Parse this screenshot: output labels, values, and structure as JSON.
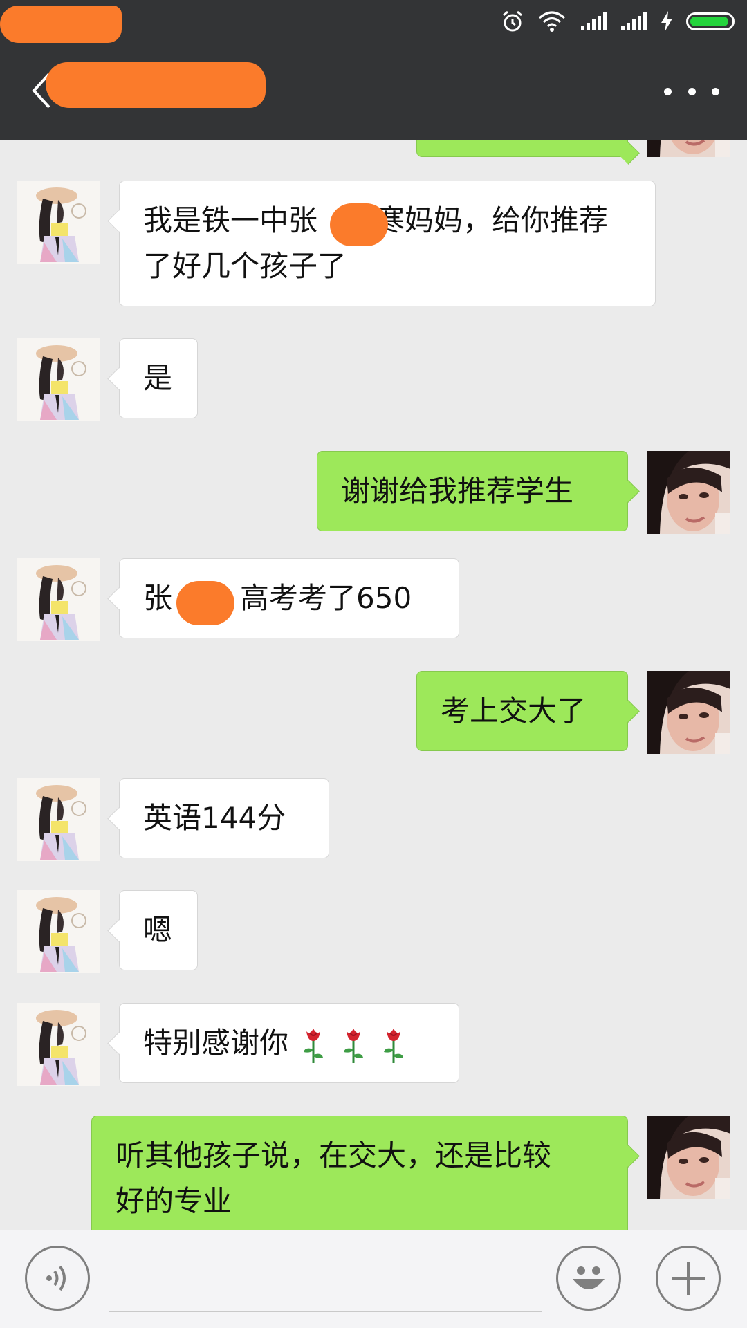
{
  "header": {
    "title": "",
    "back_icon": "chevron-left-icon",
    "more_icon": "more-dots-icon"
  },
  "status_bar": {
    "icons": [
      "alarm-icon",
      "wifi-icon",
      "signal-icon",
      "signal-icon",
      "charging-icon",
      "battery-icon"
    ],
    "battery_color": "#25d43d"
  },
  "colors": {
    "topbar": "#333436",
    "chat_background": "#ebebeb",
    "bubble_received": "#ffffff",
    "bubble_sent": "#9de85a",
    "redaction": "#fb7b2b"
  },
  "messages": [
    {
      "side": "left",
      "lines": [
        "我是铁一中张",
        "寒妈妈，给你推荐",
        "了好几个孩子了"
      ]
    },
    {
      "side": "left",
      "text": "是"
    },
    {
      "side": "right",
      "text": "谢谢给我推荐学生"
    },
    {
      "side": "left",
      "parts": [
        "张",
        "高考考了650"
      ]
    },
    {
      "side": "right",
      "text": "考上交大了"
    },
    {
      "side": "left",
      "text": "英语144分"
    },
    {
      "side": "left",
      "text": "嗯"
    },
    {
      "side": "left",
      "text": "特别感谢你",
      "emoji": [
        "rose-icon",
        "rose-icon",
        "rose-icon"
      ]
    },
    {
      "side": "right",
      "lines": [
        "听其他孩子说，在交大，还是比较",
        "好的专业"
      ]
    }
  ],
  "input_bar": {
    "voice_icon": "voice-icon",
    "emoji_icon": "emoji-icon",
    "plus_icon": "plus-icon",
    "text_value": ""
  }
}
